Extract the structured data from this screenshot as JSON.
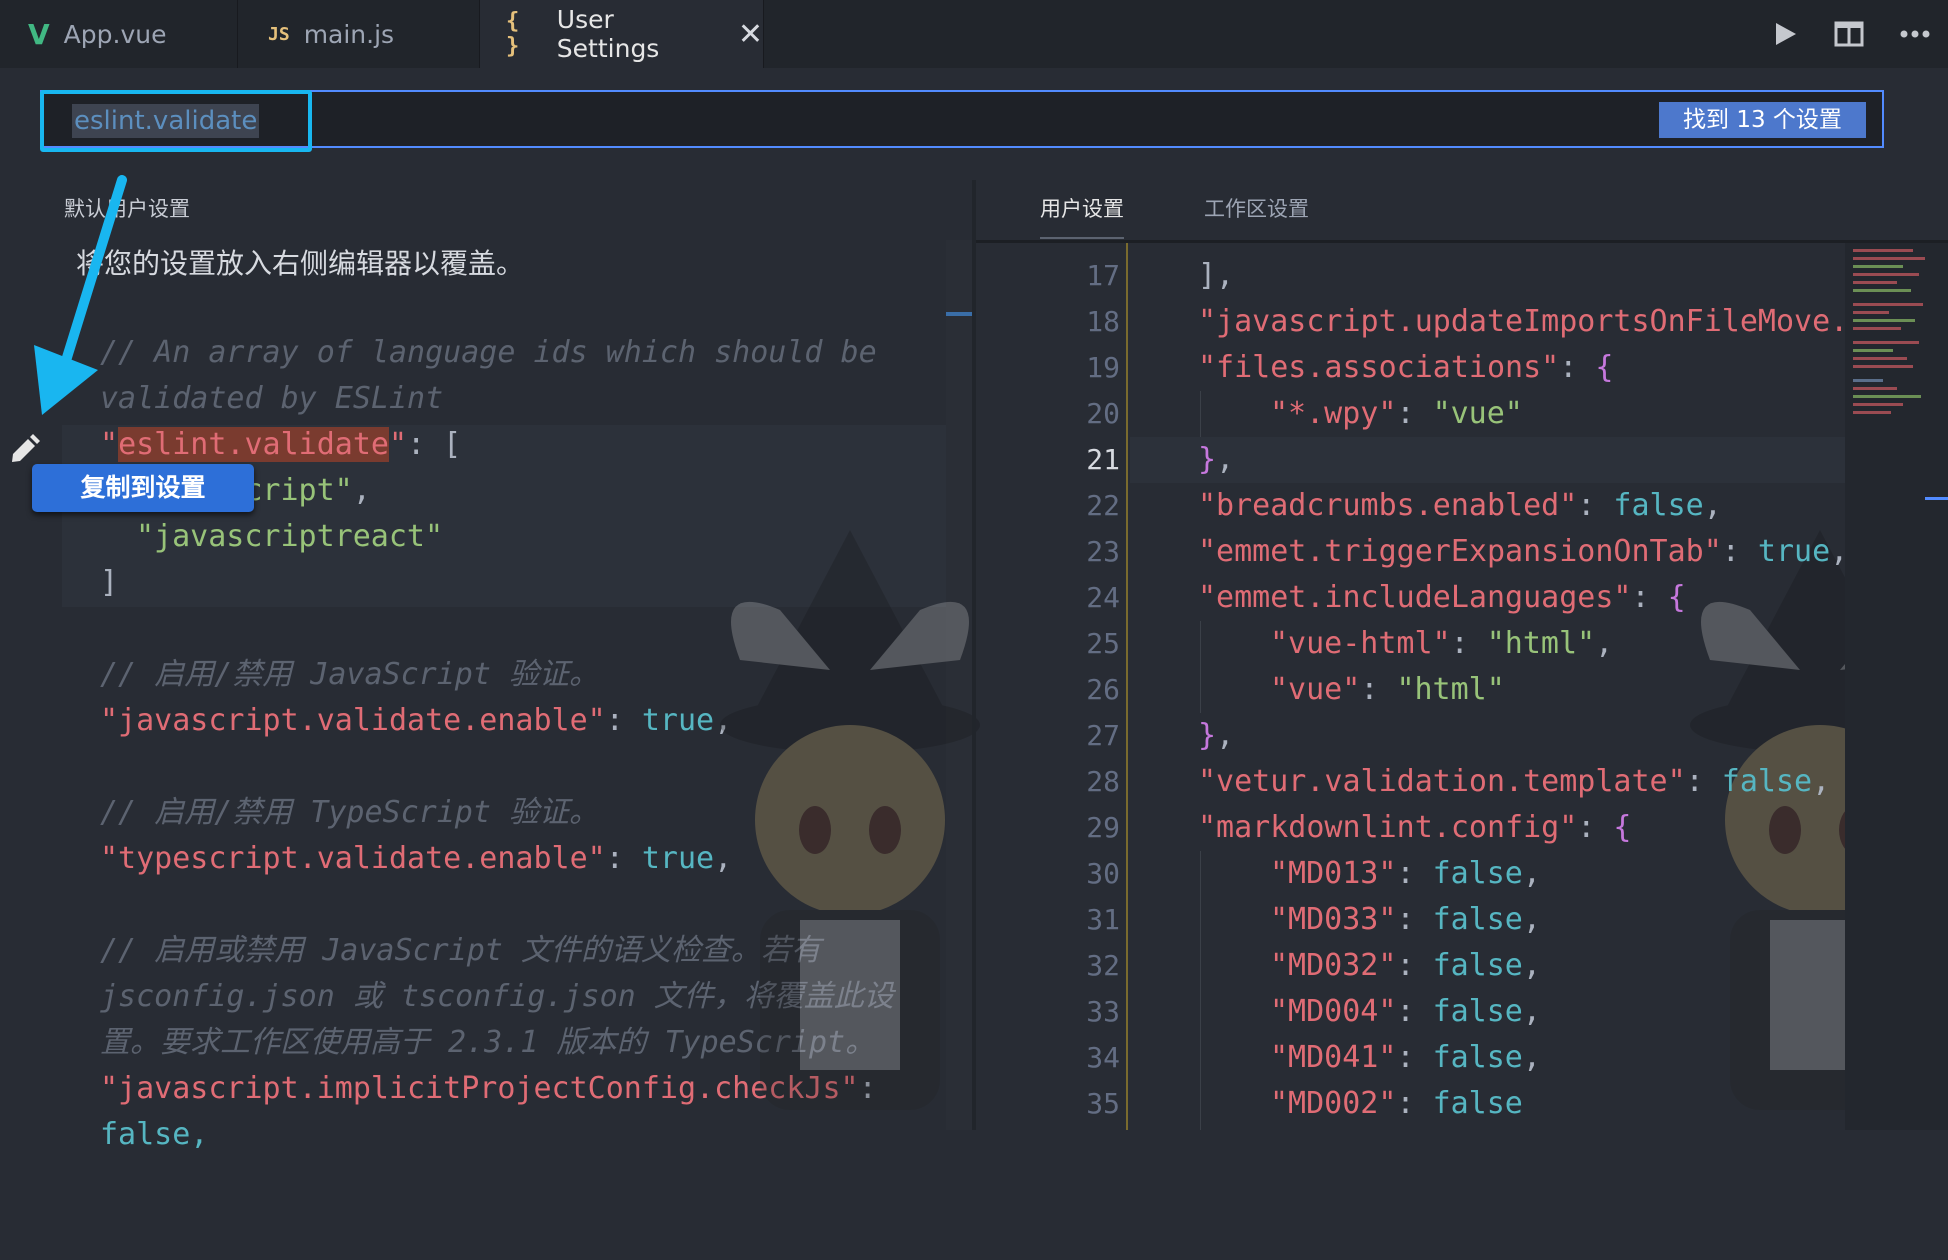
{
  "tabs": [
    {
      "label": "App.vue",
      "icon": "vue-icon",
      "glyph": "V"
    },
    {
      "label": "main.js",
      "icon": "js-icon",
      "glyph": "JS"
    },
    {
      "label": "User Settings",
      "icon": "braces-icon",
      "glyph": "{ }",
      "close": "✕"
    }
  ],
  "search": {
    "value": "eslint.validate",
    "found": "找到 13 个设置"
  },
  "left": {
    "title": "默认用户设置",
    "subtitle": "将您的设置放入右侧编辑器以覆盖。",
    "copy_popup": "复制到设置"
  },
  "right": {
    "tab_user": "用户设置",
    "tab_workspace": "工作区设置"
  },
  "gutter": [
    "17",
    "18",
    "19",
    "20",
    "21",
    "22",
    "23",
    "24",
    "25",
    "26",
    "27",
    "28",
    "29",
    "30",
    "31",
    "32",
    "33",
    "34",
    "35"
  ],
  "current_line": "21",
  "colors": {
    "accent": "#528bff",
    "highlight_border": "#18b7f0",
    "badge": "#4d78cc"
  }
}
